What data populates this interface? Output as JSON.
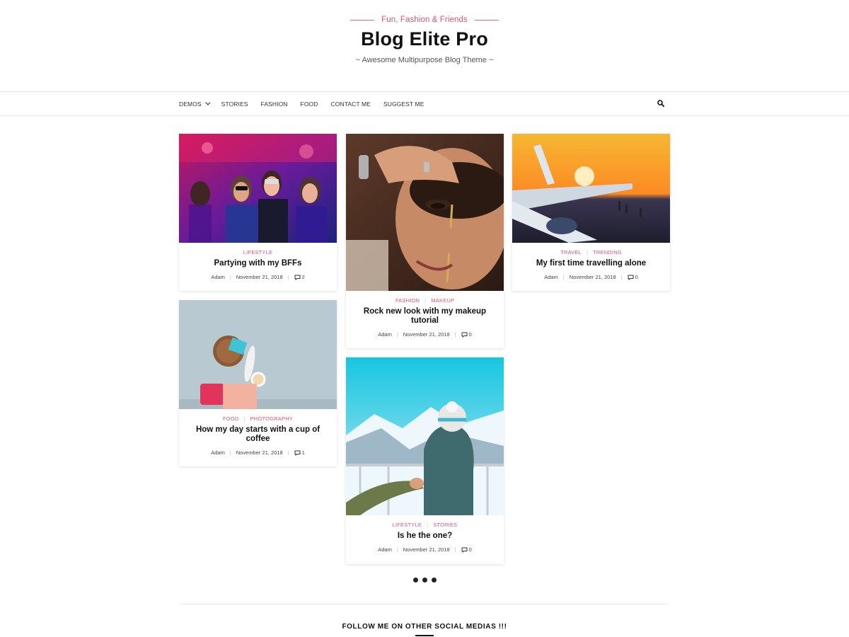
{
  "header": {
    "tagline": "Fun, Fashion & Friends",
    "title": "Blog Elite Pro",
    "description": "~ Awesome Multipurpose Blog Theme ~"
  },
  "nav": {
    "items": [
      "DEMOS",
      "STORIES",
      "FASHION",
      "FOOD",
      "CONTACT ME",
      "SUGGEST ME"
    ],
    "search_icon": "search-icon"
  },
  "posts": [
    {
      "image": "party-photo",
      "categories": [
        "LIFESTYLE"
      ],
      "title": "Partying with my BFFs",
      "author": "Adam",
      "date": "November 21, 2018",
      "comments": "2"
    },
    {
      "image": "makeup-photo",
      "categories": [
        "FASHION",
        "MAKEUP"
      ],
      "title": "Rock new look with my makeup tutorial",
      "author": "Adam",
      "date": "November 21, 2018",
      "comments": "0"
    },
    {
      "image": "airplane-photo",
      "categories": [
        "TRAVEL",
        "TRENDING"
      ],
      "title": "My first time travelling alone",
      "author": "Adam",
      "date": "November 21, 2018",
      "comments": "0"
    },
    {
      "image": "coffee-flatlay-photo",
      "categories": [
        "FOOD",
        "PHOTOGRAPHY"
      ],
      "title": "How my day starts with a cup of coffee",
      "author": "Adam",
      "date": "November 21, 2018",
      "comments": "1"
    },
    {
      "image": "snow-mountain-photo",
      "categories": [
        "LIFESTYLE",
        "STORIES"
      ],
      "title": "Is he the one?",
      "author": "Adam",
      "date": "November 21, 2018",
      "comments": "0"
    }
  ],
  "footer": {
    "follow_text": "FOLLOW ME ON OTHER SOCIAL MEDIAS !!!"
  },
  "colors": {
    "accent": "#d9556b",
    "text": "#111111"
  }
}
